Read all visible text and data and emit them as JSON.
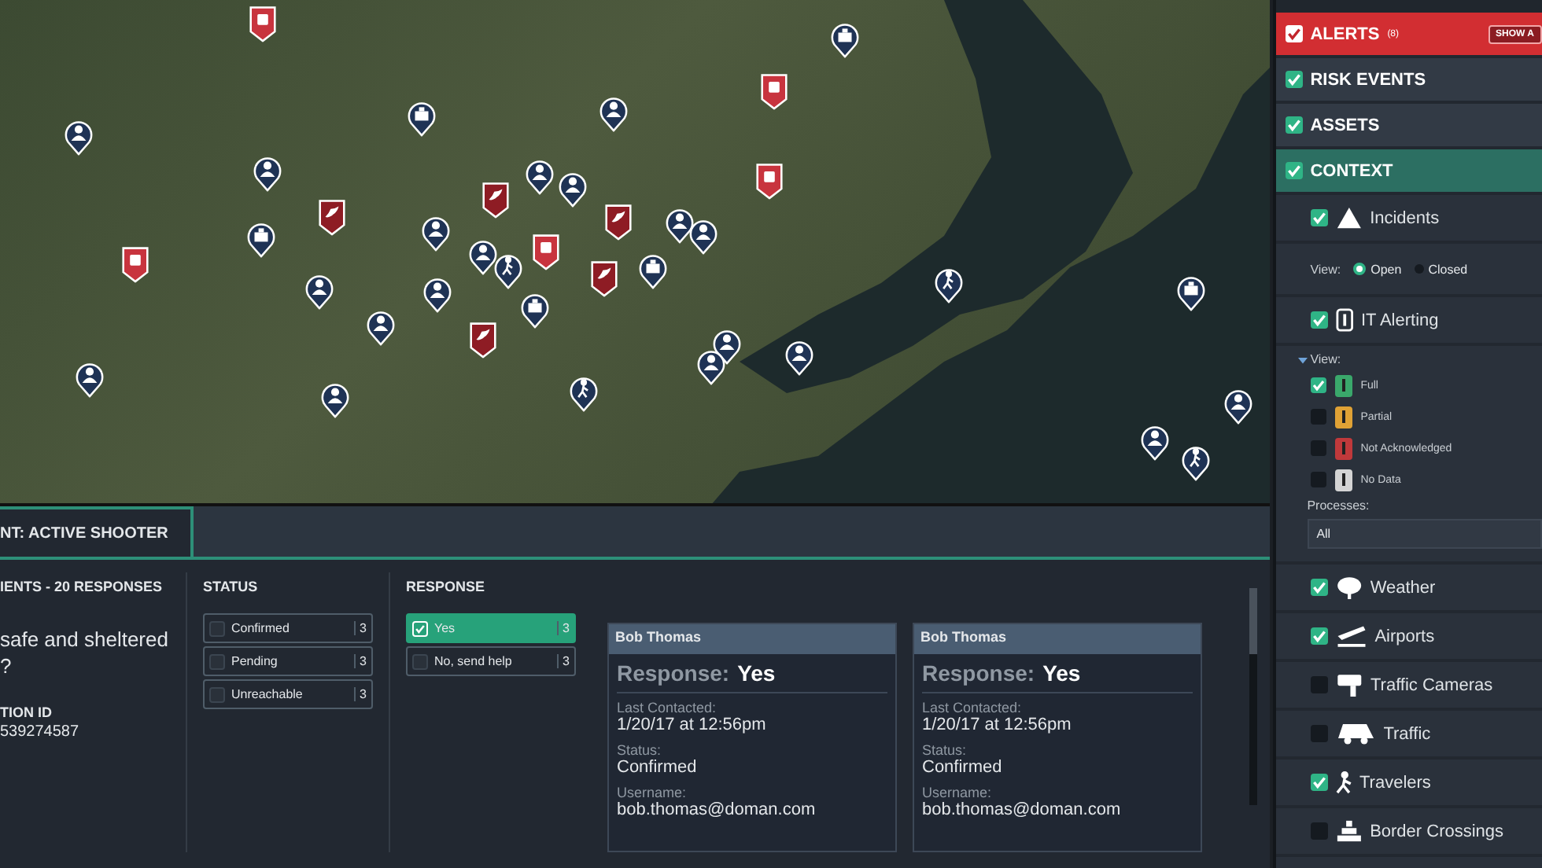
{
  "sidebar": {
    "rows": [
      {
        "kind": "alerts",
        "label": "ALERTS",
        "count": "(8)",
        "checked": true,
        "button": "SHOW A"
      },
      {
        "kind": "group",
        "label": "RISK EVENTS",
        "checked": true,
        "selected": false
      },
      {
        "kind": "group",
        "label": "ASSETS",
        "checked": true,
        "selected": false
      },
      {
        "kind": "group",
        "label": "CONTEXT",
        "checked": true,
        "selected": true
      },
      {
        "kind": "layer",
        "label": "Incidents",
        "checked": true
      },
      {
        "kind": "view",
        "label": "View:",
        "options": [
          {
            "label": "Open",
            "selected": true
          },
          {
            "label": "Closed",
            "selected": false
          }
        ]
      },
      {
        "kind": "layer",
        "label": "IT Alerting",
        "checked": true
      },
      {
        "kind": "statuses",
        "label": "View:",
        "expanded": true,
        "options": [
          {
            "label": "Full",
            "checked": true,
            "color": "#3aa86b"
          },
          {
            "label": "Partial",
            "checked": false,
            "color": "#e0a235"
          },
          {
            "label": "Not Acknowledged",
            "checked": false,
            "color": "#c0393b"
          },
          {
            "label": "No Data",
            "checked": false,
            "color": "#d4d4d4"
          }
        ]
      },
      {
        "kind": "select",
        "label": "Processes:",
        "value": "All"
      },
      {
        "kind": "layer",
        "label": "Weather",
        "checked": true
      },
      {
        "kind": "layer",
        "label": "Airports",
        "checked": true
      },
      {
        "kind": "layer",
        "label": "Traffic Cameras",
        "checked": false
      },
      {
        "kind": "layer",
        "label": "Traffic",
        "checked": false
      },
      {
        "kind": "layer",
        "label": "Travelers",
        "checked": true
      },
      {
        "kind": "layer",
        "label": "Border Crossings",
        "checked": false
      }
    ]
  },
  "panel": {
    "tab": "NT: ACTIVE SHOOTER",
    "heading": "IENTS - 20 RESPONSES",
    "question": [
      "safe and sheltered",
      "?"
    ],
    "id_label": "TION ID",
    "id_value": "539274587",
    "status": {
      "heading": "STATUS",
      "options": [
        {
          "label": "Confirmed",
          "count": "3",
          "selected": false
        },
        {
          "label": "Pending",
          "count": "3",
          "selected": false
        },
        {
          "label": "Unreachable",
          "count": "3",
          "selected": false
        }
      ]
    },
    "response": {
      "heading": "RESPONSE",
      "options": [
        {
          "label": "Yes",
          "count": "3",
          "selected": true
        },
        {
          "label": "No, send help",
          "count": "3",
          "selected": false
        }
      ]
    },
    "cards": [
      {
        "name": "Bob Thomas",
        "response_label": "Response:",
        "response": "Yes",
        "fields": [
          {
            "label": "Last Contacted:",
            "value": "1/20/17 at 12:56pm"
          },
          {
            "label": "Status:",
            "value": "Confirmed"
          },
          {
            "label": "Username:",
            "value": "bob.thomas@doman.com"
          }
        ]
      },
      {
        "name": "Bob Thomas",
        "response_label": "Response:",
        "response": "Yes",
        "fields": [
          {
            "label": "Last Contacted:",
            "value": "1/20/17 at 12:56pm"
          },
          {
            "label": "Status:",
            "value": "Confirmed"
          },
          {
            "label": "Username:",
            "value": "bob.thomas@doman.com"
          }
        ]
      }
    ]
  }
}
